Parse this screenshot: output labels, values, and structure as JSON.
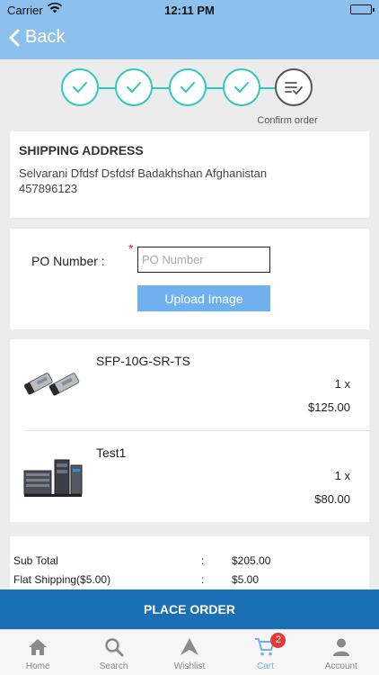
{
  "status_bar": {
    "carrier": "Carrier",
    "time": "12:11 PM"
  },
  "nav": {
    "back_label": "Back"
  },
  "stepper": {
    "completed_steps": 4,
    "total_steps": 5,
    "current_caption": "Confirm order",
    "accent_color": "#2ec9c1"
  },
  "shipping": {
    "title": "SHIPPING ADDRESS",
    "address_line1": "Selvarani Dfdsf Dsfdsf Badakhshan Afghanistan",
    "address_line2": "457896123"
  },
  "po": {
    "label": "PO Number  :",
    "required_mark": "*",
    "value": "",
    "placeholder": "PO Number",
    "upload_label": "Upload Image"
  },
  "cart": {
    "items": [
      {
        "name": "SFP-10G-SR-TS",
        "qty": "1 x",
        "price": "$125.00",
        "image_icon": "sfp-module-image"
      },
      {
        "name": "Test1",
        "qty": "1 x",
        "price": "$80.00",
        "image_icon": "network-switch-image"
      }
    ]
  },
  "totals": {
    "rows": [
      {
        "label": "Sub Total",
        "colon": ":",
        "value": "$205.00"
      },
      {
        "label": "Flat Shipping($5.00)",
        "colon": ":",
        "value": "$5.00"
      }
    ]
  },
  "place_order_label": "PLACE ORDER",
  "tabbar": {
    "tabs": [
      {
        "label": "Home",
        "icon": "home-icon"
      },
      {
        "label": "Search",
        "icon": "search-icon"
      },
      {
        "label": "Wishlist",
        "icon": "wishlist-icon"
      },
      {
        "label": "Cart",
        "icon": "cart-icon",
        "badge": "2",
        "active": true
      },
      {
        "label": "Account",
        "icon": "account-icon"
      }
    ]
  }
}
